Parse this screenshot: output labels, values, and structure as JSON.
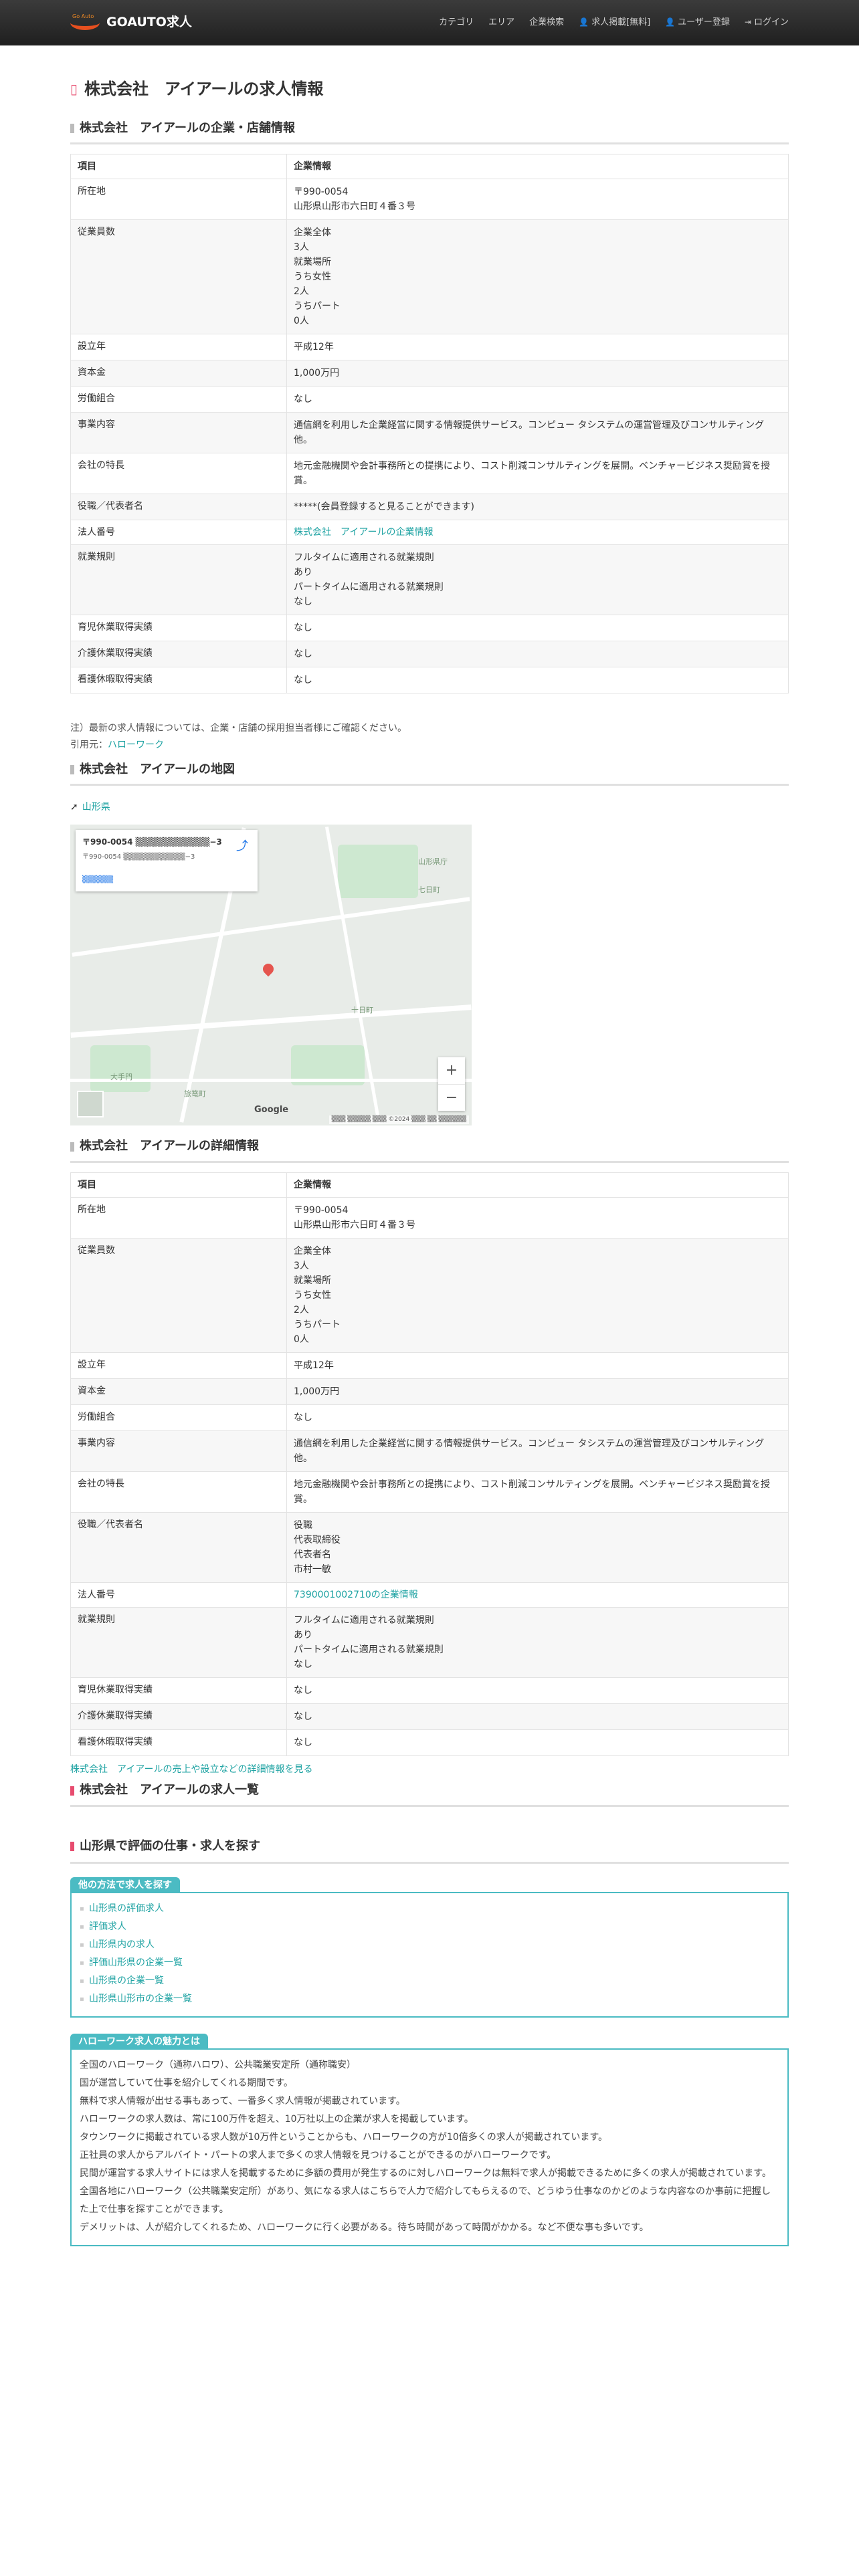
{
  "nav": {
    "brand": "GOAUTO求人",
    "brand_small": "Go Auto",
    "links": [
      "カテゴリ",
      "エリア",
      "企業検索",
      "求人掲載[無料]",
      "ユーザー登録",
      "ログイン"
    ]
  },
  "page_title": "株式会社　アイアールの求人情報",
  "company_section": {
    "heading": "株式会社　アイアールの企業・店舗情報",
    "col_item": "項目",
    "col_info": "企業情報",
    "rows": [
      {
        "label": "所在地",
        "lines": [
          "〒990-0054",
          "山形県山形市六日町４番３号"
        ]
      },
      {
        "label": "従業員数",
        "lines": [
          "企業全体",
          "3人",
          "就業場所",
          "うち女性",
          "2人",
          "うちパート",
          "0人"
        ]
      },
      {
        "label": "設立年",
        "lines": [
          "平成12年"
        ]
      },
      {
        "label": "資本金",
        "lines": [
          "1,000万円"
        ]
      },
      {
        "label": "労働組合",
        "lines": [
          "なし"
        ]
      },
      {
        "label": "事業内容",
        "lines": [
          "通信網を利用した企業経営に関する情報提供サービス。コンピュー タシステムの運営管理及びコンサルティング他。"
        ]
      },
      {
        "label": "会社の特長",
        "lines": [
          "地元金融機関や会計事務所との提携により、コスト削減コンサルティングを展開。ベンチャービジネス奨励賞を授賞。"
        ]
      },
      {
        "label": "役職／代表者名",
        "lines": [
          "*****(会員登録すると見ることができます)"
        ]
      },
      {
        "label": "法人番号",
        "link": "株式会社　アイアールの企業情報"
      },
      {
        "label": "就業規則",
        "lines": [
          "フルタイムに適用される就業規則",
          "あり",
          "パートタイムに適用される就業規則",
          "なし"
        ]
      },
      {
        "label": "育児休業取得実績",
        "lines": [
          "なし"
        ]
      },
      {
        "label": "介護休業取得実績",
        "lines": [
          "なし"
        ]
      },
      {
        "label": "看護休暇取得実績",
        "lines": [
          "なし"
        ]
      }
    ]
  },
  "note": "注）最新の求人情報については、企業・店舗の採用担当者様にご確認ください。",
  "source_label": "引用元：",
  "source_link": "ハローワーク",
  "map_section": {
    "heading": "株式会社　アイアールの地図",
    "location_link": "山形県",
    "card_title": "〒990-0054 ▒▒▒▒▒▒▒▒▒▒▒▒−3",
    "card_sub": "〒990-0054 ▒▒▒▒▒▒▒▒▒▒▒▒−3",
    "card_link": "▒▒▒▒▒▒",
    "dir_label": "▒▒",
    "zoom_in": "+",
    "zoom_out": "−",
    "google": "Google",
    "copyright": "▒▒▒ ▒▒▒▒▒ ▒▒▒ ©2024 ▒▒▒ ▒▒ ▒▒▒▒▒▒",
    "labels": [
      "山形県庁",
      "七日町",
      "十日町",
      "旅篭町",
      "大手門"
    ]
  },
  "detail_section": {
    "heading": "株式会社　アイアールの詳細情報",
    "col_item": "項目",
    "col_info": "企業情報",
    "rows": [
      {
        "label": "所在地",
        "lines": [
          "〒990-0054",
          "山形県山形市六日町４番３号"
        ]
      },
      {
        "label": "従業員数",
        "lines": [
          "企業全体",
          "3人",
          "就業場所",
          "うち女性",
          "2人",
          "うちパート",
          "0人"
        ]
      },
      {
        "label": "設立年",
        "lines": [
          "平成12年"
        ]
      },
      {
        "label": "資本金",
        "lines": [
          "1,000万円"
        ]
      },
      {
        "label": "労働組合",
        "lines": [
          "なし"
        ]
      },
      {
        "label": "事業内容",
        "lines": [
          "通信網を利用した企業経営に関する情報提供サービス。コンピュー タシステムの運営管理及びコンサルティング他。"
        ]
      },
      {
        "label": "会社の特長",
        "lines": [
          "地元金融機関や会計事務所との提携により、コスト削減コンサルティングを展開。ベンチャービジネス奨励賞を授賞。"
        ]
      },
      {
        "label": "役職／代表者名",
        "lines": [
          "役職",
          "代表取締役",
          "代表者名",
          "市村一敏"
        ]
      },
      {
        "label": "法人番号",
        "link": "7390001002710の企業情報"
      },
      {
        "label": "就業規則",
        "lines": [
          "フルタイムに適用される就業規則",
          "あり",
          "パートタイムに適用される就業規則",
          "なし"
        ]
      },
      {
        "label": "育児休業取得実績",
        "lines": [
          "なし"
        ]
      },
      {
        "label": "介護休業取得実績",
        "lines": [
          "なし"
        ]
      },
      {
        "label": "看護休暇取得実績",
        "lines": [
          "なし"
        ]
      }
    ]
  },
  "sales_link": "株式会社　アイアールの売上や設立などの詳細情報を見る",
  "jobs_heading": "株式会社　アイアールの求人一覧",
  "search_heading": "山形県で評価の仕事・求人を探す",
  "other_box": {
    "title": "他の方法で求人を探す",
    "items": [
      "山形県の評価求人",
      "評価求人",
      "山形県内の求人",
      "評価山形県の企業一覧",
      "山形県の企業一覧",
      "山形県山形市の企業一覧"
    ]
  },
  "hw_box": {
    "title": "ハローワーク求人の魅力とは",
    "lines": [
      "全国のハローワーク（通称ハロワ）、公共職業安定所（通称職安）",
      "国が運営していて仕事を紹介してくれる期間です。",
      "無料で求人情報が出せる事もあって、一番多く求人情報が掲載されています。",
      "ハローワークの求人数は、常に100万件を超え、10万社以上の企業が求人を掲載しています。",
      "タウンワークに掲載されている求人数が10万件ということからも、ハローワークの方が10倍多くの求人が掲載されています。",
      "正社員の求人からアルバイト・パートの求人まで多くの求人情報を見つけることができるのがハローワークです。",
      "民間が運営する求人サイトには求人を掲載するために多額の費用が発生するのに対しハローワークは無料で求人が掲載できるために多くの求人が掲載されています。",
      "全国各地にハローワーク（公共職業安定所）があり、気になる求人はこちらで人力で紹介してもらえるので、どうゆう仕事なのかどのような内容なのか事前に把握した上で仕事を探すことができます。",
      "デメリットは、人が紹介してくれるため、ハローワークに行く必要がある。待ち時間があって時間がかかる。など不便な事も多いです。"
    ]
  }
}
